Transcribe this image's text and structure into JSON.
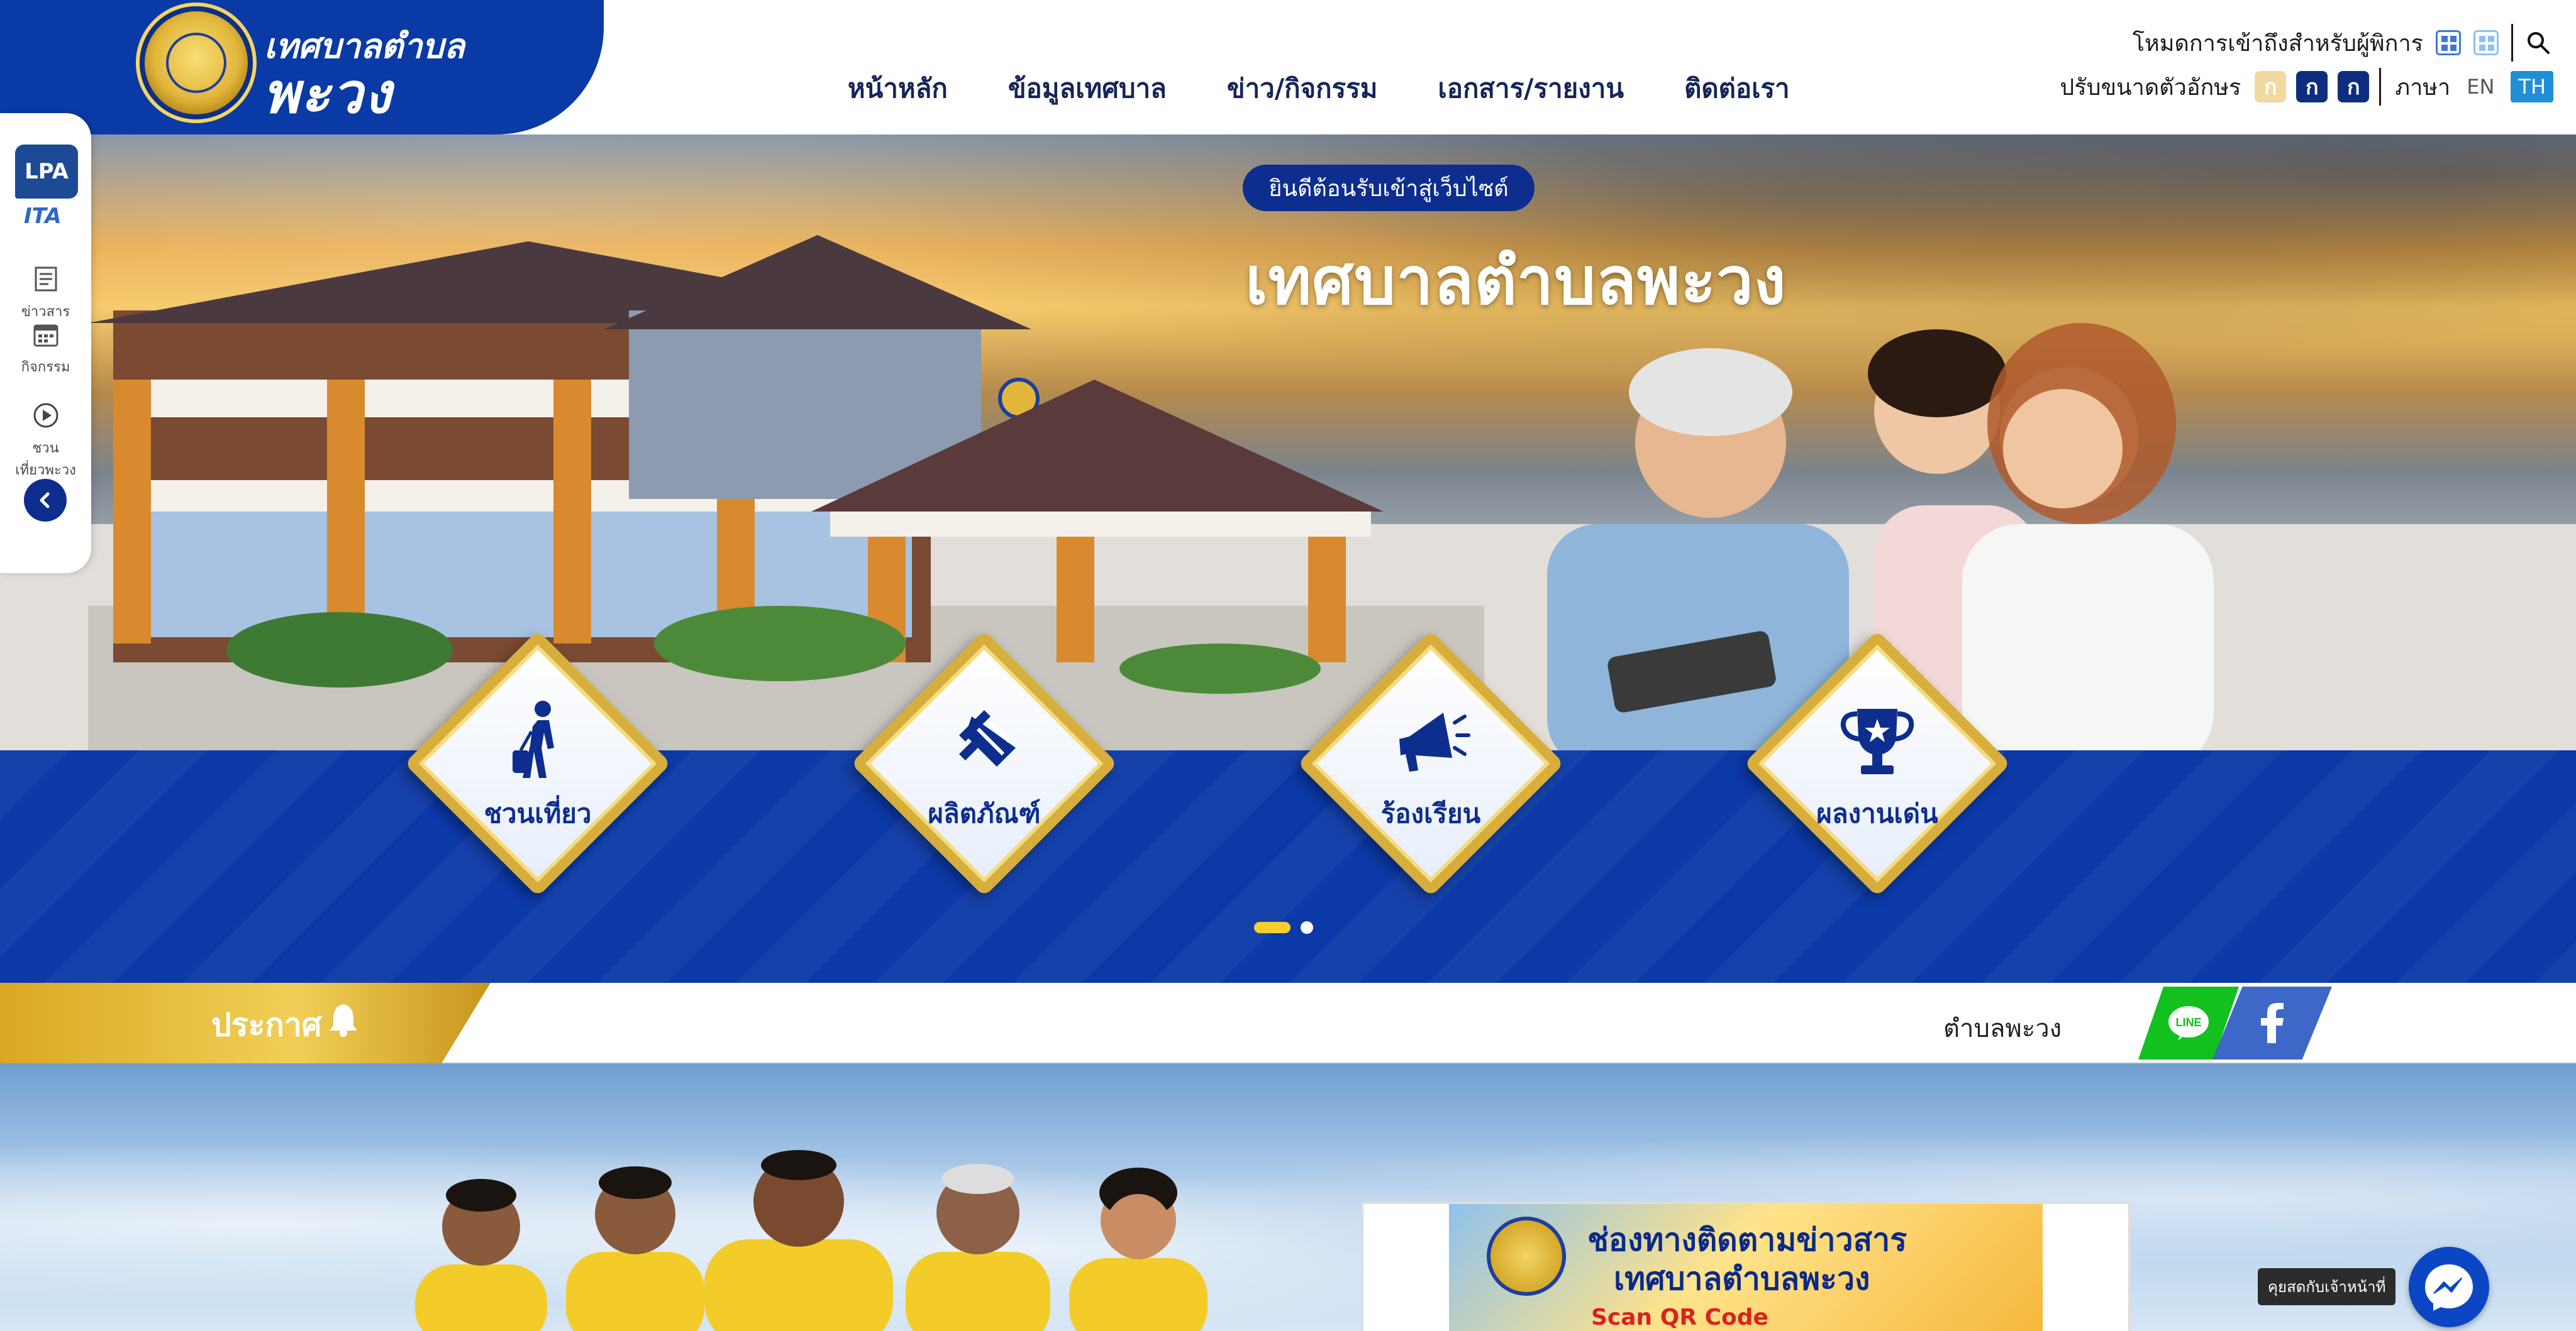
{
  "brand": {
    "line1": "เทศบาลตำบล",
    "line2": "พะวง"
  },
  "nav": {
    "items": [
      {
        "label": "หน้าหลัก"
      },
      {
        "label": "ข้อมูลเทศบาล"
      },
      {
        "label": "ข่าว/กิจกรรม"
      },
      {
        "label": "เอกสาร/รายงาน"
      },
      {
        "label": "ติดต่อเรา"
      }
    ]
  },
  "accessibility": {
    "label": "โหมดการเข้าถึงสำหรับผู้พิการ",
    "font_size_label": "ปรับขนาดตัวอักษร",
    "font_buttons": [
      "ก",
      "ก",
      "ก"
    ],
    "language_label": "ภาษา",
    "lang_en": "EN",
    "lang_th": "TH"
  },
  "hero": {
    "welcome": "ยินดีต้อนรับเข้าสู่เว็บไซต์",
    "title": "เทศบาลตำบลพะวง"
  },
  "quick_links": [
    {
      "label": "ชวนเที่ยว",
      "icon": "traveler-icon"
    },
    {
      "label": "ผลิตภัณฑ์",
      "icon": "product-icon"
    },
    {
      "label": "ร้องเรียน",
      "icon": "megaphone-icon"
    },
    {
      "label": "ผลงานเด่น",
      "icon": "trophy-icon"
    }
  ],
  "side_menu": {
    "lpa": "LPA",
    "ita": "ITA",
    "items": [
      {
        "label": "ข่าวสาร",
        "icon": "newspaper-icon"
      },
      {
        "label": "กิจกรรม",
        "icon": "calendar-icon"
      },
      {
        "label": "ชวน\nเที่ยวพะวง",
        "icon": "play-icon"
      }
    ]
  },
  "announcement": {
    "label": "ประกาศ",
    "ticker": "ตำบลพะวง"
  },
  "news_card": {
    "line1": "ช่องทางติดตามข่าวสาร",
    "line2": "เทศบาลตำบลพะวง",
    "line3": "Scan QR Code"
  },
  "chat": {
    "label": "คุยสดกับเจ้าหน้าที่"
  },
  "colors": {
    "primary_blue": "#0b39a8",
    "gold": "#d7ae3c",
    "line_green": "#12c11e",
    "facebook_blue": "#3d68c8"
  }
}
